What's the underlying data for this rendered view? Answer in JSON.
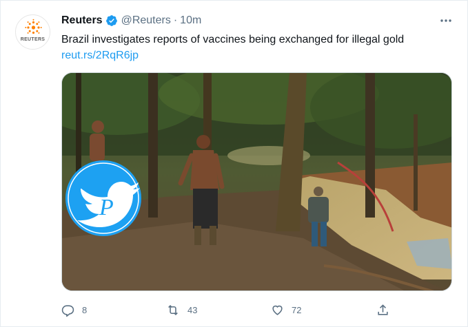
{
  "tweet": {
    "author": {
      "name": "Reuters",
      "handle": "@Reuters",
      "avatar_text": "REUTERS",
      "verified_icon": "verified-badge-icon"
    },
    "time": "10m",
    "separator": "·",
    "text": "Brazil investigates reports of vaccines being exchanged for illegal gold",
    "link": "reut.rs/2RqR6jp",
    "media": {
      "description_icon": "forest-mining-photo",
      "overlay_icon": "twitter-bird-logo"
    },
    "actions": {
      "replies": "8",
      "retweets": "43",
      "likes": "72"
    }
  },
  "colors": {
    "accent": "#1d9bf0",
    "muted": "#5b7083",
    "text": "#0f1419",
    "reuters_orange": "#ff8000"
  }
}
